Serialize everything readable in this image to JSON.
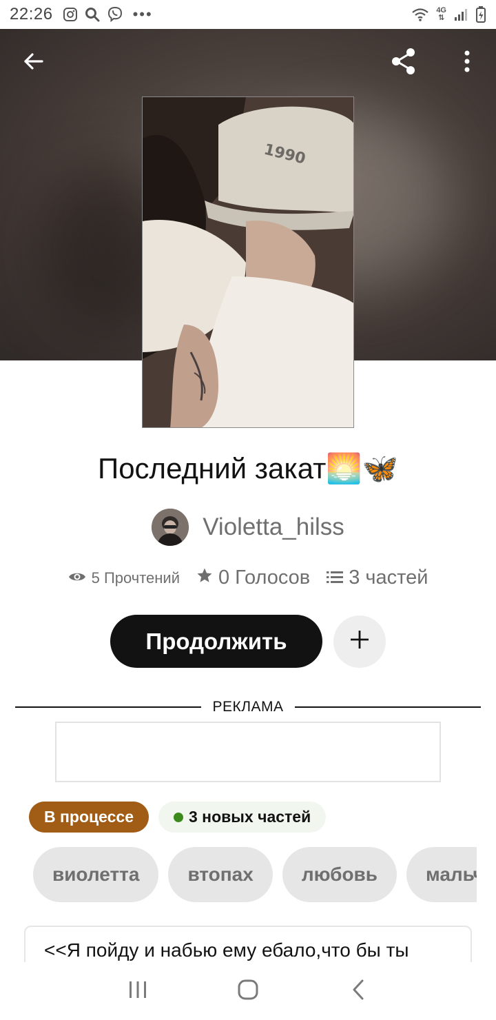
{
  "status_bar": {
    "time": "22:26",
    "network_type": "4G",
    "icons_left": [
      "instagram-icon",
      "search-icon",
      "viber-icon",
      "more-dots-icon"
    ],
    "icons_right": [
      "wifi-icon",
      "network-4g-icon",
      "signal-icon",
      "battery-icon"
    ]
  },
  "header": {
    "icons": [
      "back-arrow-icon",
      "share-icon",
      "more-vertical-icon"
    ]
  },
  "story": {
    "title": "Последний закат🌅🦋",
    "author": "Violetta_hilss",
    "stats": {
      "reads": "5 Прочтений",
      "votes": "0 Голосов",
      "parts": "3 частей"
    },
    "continue_label": "Продолжить",
    "add_icon": "plus-icon"
  },
  "ad": {
    "label": "РЕКЛАМА"
  },
  "badges": {
    "status": "В процессе",
    "new_parts": "3 новых частей"
  },
  "tags": [
    "виолетта",
    "втопах",
    "любовь",
    "мальчики"
  ],
  "description": {
    "first_line": "<<Я пойду и набью ему ебало,что бы ты"
  },
  "colors": {
    "primary": "#121212",
    "status_badge": "#a15c16",
    "new_dot": "#3d8a1c",
    "muted_text": "#6f6f6f"
  },
  "nav_bar": {
    "icons": [
      "recent-apps-icon",
      "home-icon",
      "back-icon"
    ]
  }
}
